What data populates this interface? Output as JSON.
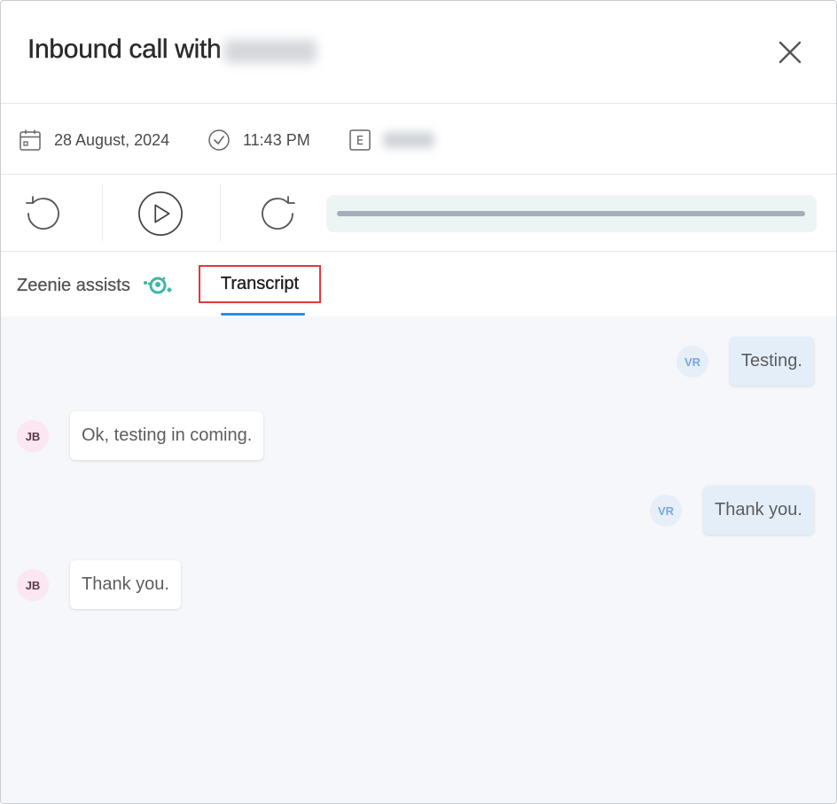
{
  "header": {
    "title": "Inbound call with",
    "close_icon": "close-icon"
  },
  "meta": {
    "date": "28 August, 2024",
    "time": "11:43 PM",
    "agent_initial": "E"
  },
  "player": {
    "rewind_icon": "rewind-icon",
    "play_icon": "play-icon",
    "forward_icon": "forward-icon",
    "progress": 0
  },
  "tabs": {
    "zeenie": "Zeenie assists",
    "transcript": "Transcript"
  },
  "transcript": {
    "messages": [
      {
        "speaker": "VR",
        "side": "right",
        "text": "Testing."
      },
      {
        "speaker": "JB",
        "side": "left",
        "text": "Ok, testing in coming."
      },
      {
        "speaker": "VR",
        "side": "right",
        "text": "Thank you."
      },
      {
        "speaker": "JB",
        "side": "left",
        "text": "Thank you."
      }
    ]
  },
  "colors": {
    "accent": "#2f8fdf",
    "highlight_border": "#e0393e",
    "zeenie": "#3fb6a8"
  }
}
